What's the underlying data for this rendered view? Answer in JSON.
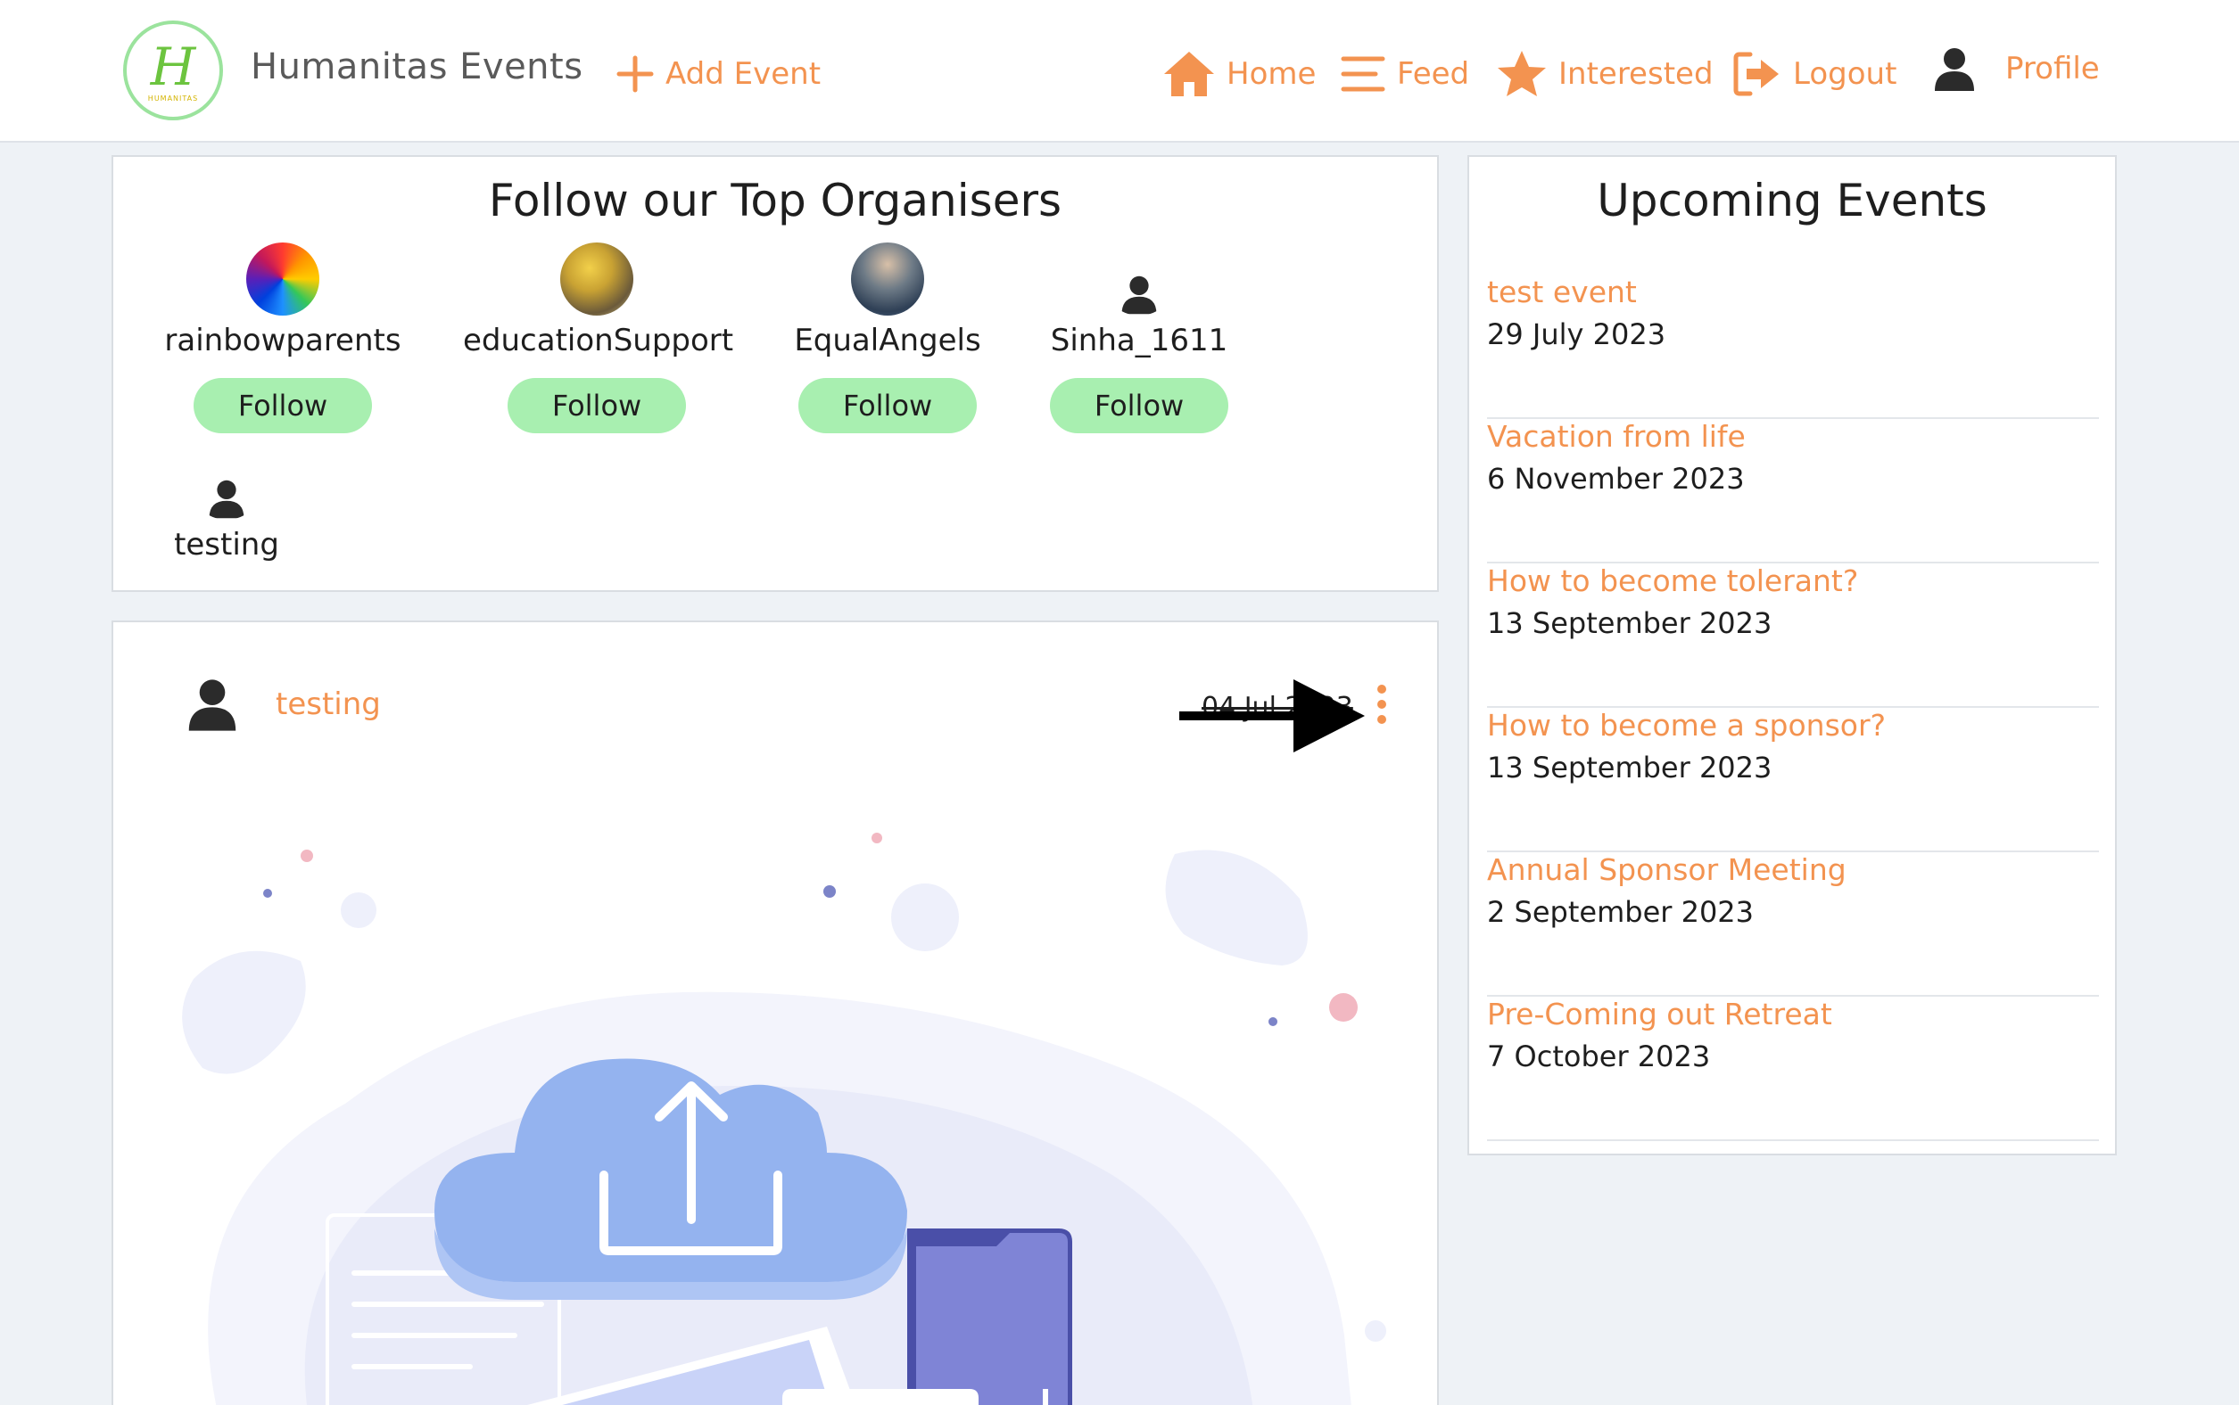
{
  "navbar": {
    "brand": "Humanitas Events",
    "logo_letter": "H",
    "logo_caption": "HUMANITAS",
    "add_event": "Add Event",
    "home": "Home",
    "feed": "Feed",
    "interested": "Interested",
    "logout": "Logout",
    "profile": "Profile"
  },
  "organisers": {
    "title": "Follow our Top Organisers",
    "follow_label": "Follow",
    "items": [
      {
        "name": "rainbowparents"
      },
      {
        "name": "educationSupport"
      },
      {
        "name": "EqualAngels"
      },
      {
        "name": "Sinha_1611"
      },
      {
        "name": "testing"
      }
    ]
  },
  "post": {
    "user": "testing",
    "date": "04 Jul 2023"
  },
  "upcoming": {
    "title": "Upcoming Events",
    "events": [
      {
        "title": "test event",
        "date": "29 July 2023"
      },
      {
        "title": "Vacation from life",
        "date": "6 November 2023"
      },
      {
        "title": "How to become tolerant?",
        "date": "13 September 2023"
      },
      {
        "title": "How to become a sponsor?",
        "date": "13 September 2023"
      },
      {
        "title": "Annual Sponsor Meeting",
        "date": "2 September 2023"
      },
      {
        "title": "Pre-Coming out Retreat",
        "date": "7 October 2023"
      }
    ]
  },
  "colors": {
    "accent": "#f39350",
    "follow_button": "#a8efb0",
    "background": "#eef2f6"
  }
}
